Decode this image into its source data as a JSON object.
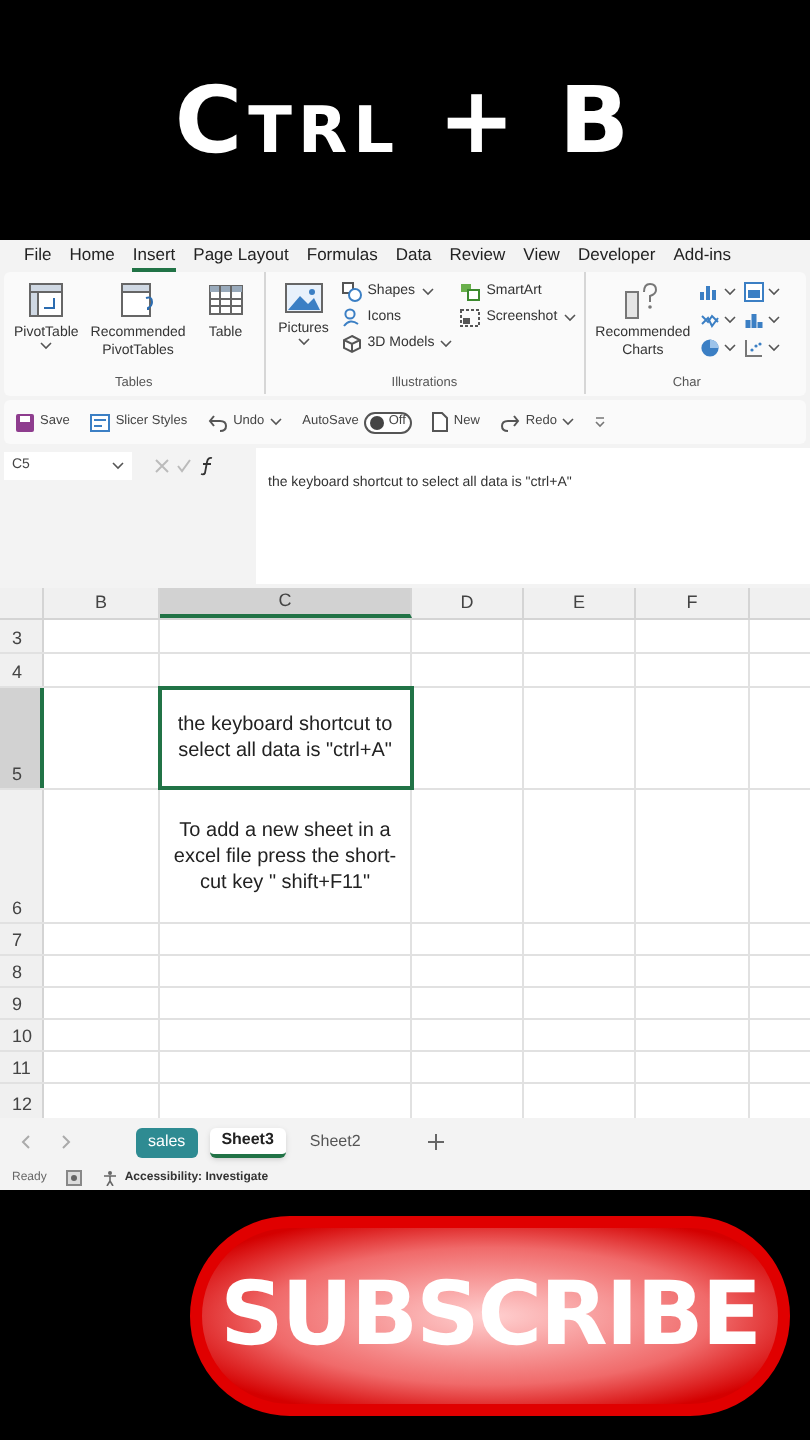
{
  "banner": {
    "title": "Ctrl + B"
  },
  "menu_tabs": [
    {
      "label": "File",
      "selected": false
    },
    {
      "label": "Home",
      "selected": false
    },
    {
      "label": "Insert",
      "selected": true
    },
    {
      "label": "Page Layout",
      "selected": false
    },
    {
      "label": "Formulas",
      "selected": false
    },
    {
      "label": "Data",
      "selected": false
    },
    {
      "label": "Review",
      "selected": false
    },
    {
      "label": "View",
      "selected": false
    },
    {
      "label": "Developer",
      "selected": false
    },
    {
      "label": "Add-ins",
      "selected": false
    }
  ],
  "ribbon": {
    "groups": [
      {
        "label": "Tables",
        "items": [
          {
            "kind": "large",
            "label": "PivotTable",
            "dropdown": true
          },
          {
            "kind": "large",
            "label": "Recommended PivotTables",
            "dropdown": false
          },
          {
            "kind": "large",
            "label": "Table",
            "dropdown": false
          }
        ]
      },
      {
        "label": "Illustrations",
        "items": [
          {
            "kind": "large",
            "label": "Pictures",
            "dropdown": true
          },
          {
            "kind": "small",
            "label": "Shapes",
            "dropdown": true
          },
          {
            "kind": "small",
            "label": "Icons",
            "dropdown": false
          },
          {
            "kind": "small",
            "label": "3D Models",
            "dropdown": true
          },
          {
            "kind": "small",
            "label": "SmartArt",
            "dropdown": false
          },
          {
            "kind": "small",
            "label": "Screenshot",
            "dropdown": true
          }
        ]
      },
      {
        "label": "Char",
        "items": [
          {
            "kind": "large",
            "label": "Recommended Charts",
            "dropdown": false
          },
          {
            "kind": "icon",
            "dropdown": true
          },
          {
            "kind": "icon",
            "dropdown": true
          },
          {
            "kind": "icon",
            "dropdown": true
          },
          {
            "kind": "icon",
            "dropdown": true
          },
          {
            "kind": "icon",
            "dropdown": true
          },
          {
            "kind": "icon",
            "dropdown": true
          }
        ]
      }
    ]
  },
  "quick_access": [
    {
      "kind": "button",
      "label": "Save",
      "dropdown": false
    },
    {
      "kind": "button",
      "label": "Slicer Styles",
      "dropdown": false
    },
    {
      "kind": "button",
      "label": "Undo",
      "dropdown": true
    },
    {
      "kind": "toggle",
      "label": "AutoSave",
      "on": false,
      "state": "Off"
    },
    {
      "kind": "button",
      "label": "New",
      "dropdown": false
    },
    {
      "kind": "button",
      "label": "Redo",
      "dropdown": true
    }
  ],
  "formula_bar": {
    "name_box": "C5",
    "formula": "the keyboard shortcut to select all data is \"ctrl+A\""
  },
  "sheet": {
    "columns": [
      {
        "label": "B",
        "selected": false
      },
      {
        "label": "C",
        "selected": true
      },
      {
        "label": "D",
        "selected": false
      },
      {
        "label": "E",
        "selected": false
      },
      {
        "label": "F",
        "selected": false
      }
    ],
    "rows": [
      {
        "label": "3",
        "selected": false
      },
      {
        "label": "4",
        "selected": false
      },
      {
        "label": "5",
        "selected": true,
        "cell_c": {
          "text": "the keyboard shortcut to select all data is \"ctrl+A\"",
          "active": true
        }
      },
      {
        "label": "6",
        "selected": false,
        "cell_c": {
          "text": "To add a new sheet in a excel file press the short-cut key \" shift+F11\"",
          "active": false
        }
      },
      {
        "label": "7",
        "selected": false
      },
      {
        "label": "8",
        "selected": false
      },
      {
        "label": "9",
        "selected": false
      },
      {
        "label": "10",
        "selected": false
      },
      {
        "label": "11",
        "selected": false
      },
      {
        "label": "12",
        "selected": false
      }
    ]
  },
  "sheet_tabs": [
    {
      "label": "sales",
      "selected": false,
      "color": "#2e8b92"
    },
    {
      "label": "Sheet3",
      "selected": true
    },
    {
      "label": "Sheet2",
      "selected": false
    }
  ],
  "status_bar": {
    "status": "Ready",
    "accessibility": "Accessibility: Investigate"
  },
  "subscribe_button": {
    "label": "SUBSCRIBE"
  }
}
